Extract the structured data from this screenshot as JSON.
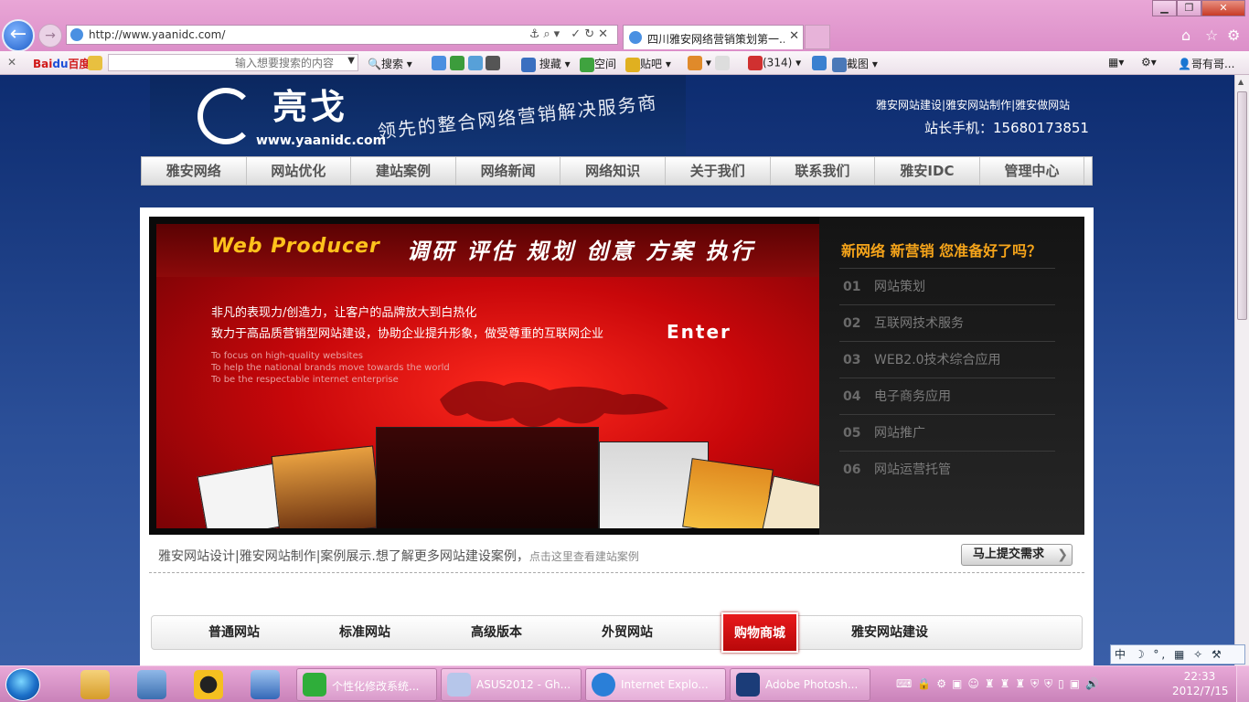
{
  "browser": {
    "url": "http://www.yaanidc.com/",
    "tab_title": "四川雅安网络营销策划第一...",
    "toolbar": {
      "baidu_search_placeholder": "输入想要搜索的内容",
      "search_label": "搜索",
      "collect_label": "搜藏",
      "space_label": "空间",
      "tieba_label": "贴吧",
      "mail_count": "(314)",
      "screenshot_label": "截图",
      "user_label": "哥有哥..."
    }
  },
  "site": {
    "logo_name": "亮戈",
    "logo_url": "www.yaanidc.com",
    "slogan": "领先的整合网络营销解决服务商",
    "top_links": [
      "雅安网站建设",
      "雅安网站制作",
      "雅安做网站"
    ],
    "phone": "站长手机：15680173851",
    "nav": [
      "雅安网络",
      "网站优化",
      "建站案例",
      "网络新闻",
      "网络知识",
      "关于我们",
      "联系我们",
      "雅安IDC",
      "管理中心"
    ],
    "banner": {
      "headline_en": "Web Producer",
      "headline_cn": "调研 评估 规划 创意 方案 执行",
      "line1": "非凡的表现力/创造力，让客户的品牌放大到白热化",
      "line2": "致力于高品质营销型网站建设，协助企业提升形象，做受尊重的互联网企业",
      "en_lines": [
        "To focus on high-quality websites",
        "To help the national brands move towards the world",
        "To be the respectable internet enterprise"
      ],
      "enter": "Enter",
      "right_title": "新网络 新营销 您准备好了吗？",
      "services": [
        {
          "num": "01",
          "label": "网站策划"
        },
        {
          "num": "02",
          "label": "互联网技术服务"
        },
        {
          "num": "03",
          "label": "WEB2.0技术综合应用"
        },
        {
          "num": "04",
          "label": "电子商务应用"
        },
        {
          "num": "05",
          "label": "网站推广"
        },
        {
          "num": "06",
          "label": "网站运营托管"
        }
      ]
    },
    "case_line": "雅安网站设计|雅安网站制作|案例展示.想了解更多网站建设案例，",
    "case_link": "点击这里查看建站案例",
    "submit_btn": "马上提交需求",
    "sub_tabs": [
      "普通网站",
      "标准网站",
      "高级版本",
      "外贸网站",
      "购物商城",
      "雅安网站建设"
    ],
    "active_sub_tab": "购物商城"
  },
  "ime": "中 ☽ °, ▦ ✧ ⚒",
  "taskbar": {
    "tasks": [
      {
        "label": "个性化修改系统...",
        "color": "#2fae3a"
      },
      {
        "label": "ASUS2012 - Gh...",
        "color": "#b6c6ea"
      },
      {
        "label": "Internet Explo...",
        "color": "#2a7fd8"
      },
      {
        "label": "Adobe Photosh...",
        "color": "#1b3c78"
      }
    ],
    "time": "22:33",
    "date": "2012/7/15"
  },
  "colors": {
    "accent_red": "#e8191b",
    "banner_gold": "#ffc21c",
    "orange_title": "#f5a41a"
  }
}
